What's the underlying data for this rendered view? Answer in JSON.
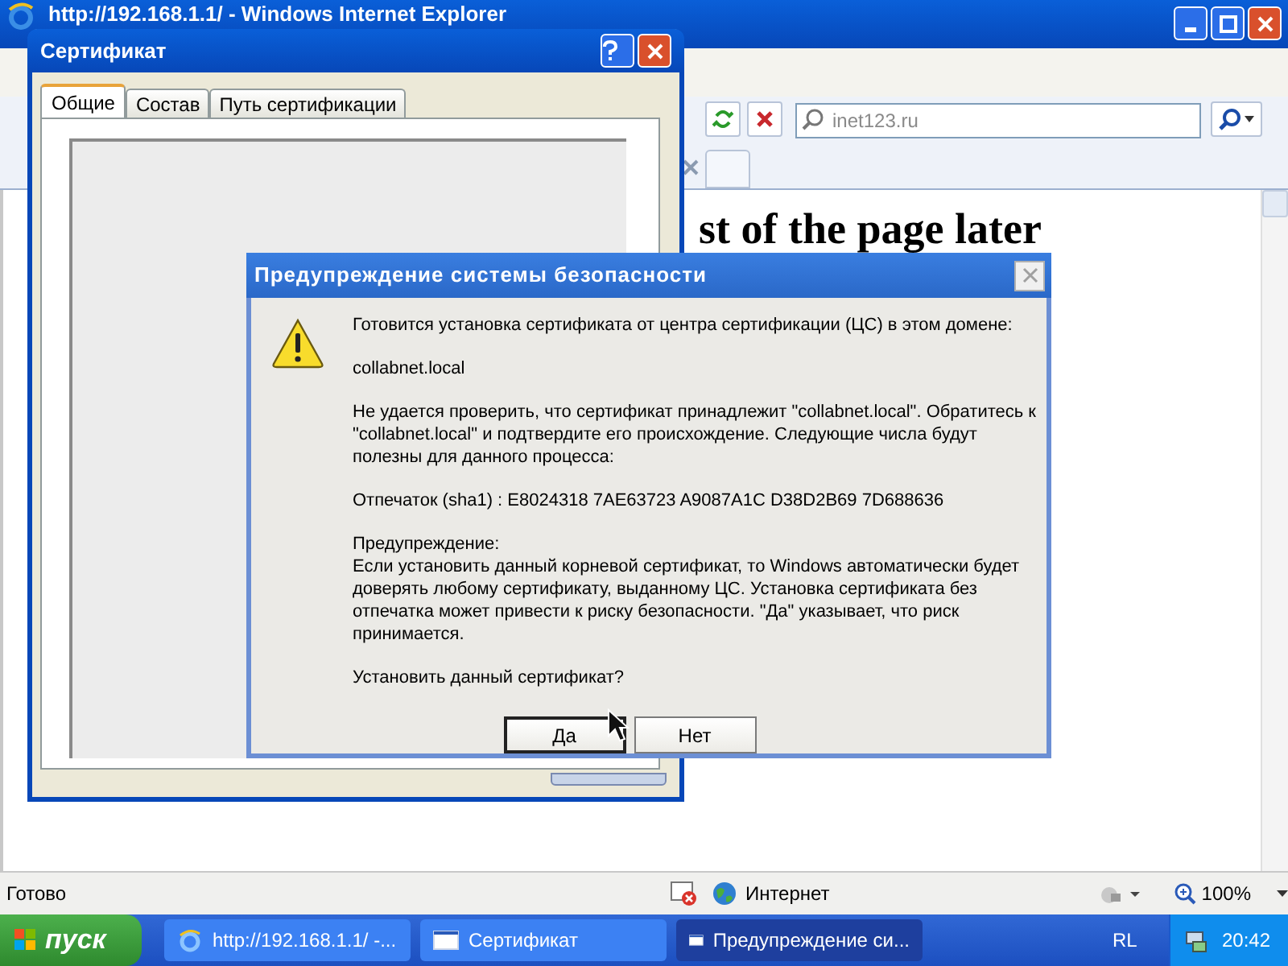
{
  "ie_window": {
    "title": "http://192.168.1.1/ - Windows Internet Explorer",
    "search": {
      "placeholder": "inet123.ru"
    },
    "page_heading": "st of the page later",
    "status_bar": {
      "status": "Готово",
      "zone": "Интернет",
      "zoom": "100%"
    }
  },
  "certificate_window": {
    "title": "Сертификат",
    "tabs": [
      {
        "label": "Общие",
        "selected": true
      },
      {
        "label": "Состав",
        "selected": false
      },
      {
        "label": "Путь сертификации",
        "selected": false
      }
    ]
  },
  "security_dialog": {
    "title": "Предупреждение системы безопасности",
    "paragraphs": [
      [
        "Готовится установка сертификата от центра сертификации (ЦС) в этом домене:"
      ],
      [
        "collabnet.local"
      ],
      [
        "Не удается проверить, что сертификат принадлежит \"collabnet.local\". Обратитесь к \"collabnet.local\" и подтвердите его происхождение. Следующие числа будут полезны для данного процесса:"
      ],
      [
        "Отпечаток (sha1) : E8024318 7AE63723 A9087A1C D38D2B69 7D688636"
      ],
      [
        "Предупреждение:",
        "Если установить данный корневой сертификат, то Windows автоматически будет доверять любому сертификату, выданному ЦС. Установка сертификата без отпечатка может привести к риску безопасности. \"Да\" указывает, что риск принимается."
      ],
      [
        "Установить данный сертификат?"
      ]
    ],
    "buttons": [
      {
        "label": "Да",
        "focused": true
      },
      {
        "label": "Нет",
        "focused": false
      }
    ]
  },
  "taskbar": {
    "start": "пуск",
    "tasks": [
      {
        "label": "http://192.168.1.1/ -...",
        "kind": "browser",
        "selected": false
      },
      {
        "label": "Сертификат",
        "kind": "window",
        "selected": false
      },
      {
        "label": "Предупреждение си...",
        "kind": "window",
        "selected": true
      }
    ],
    "language": "RL",
    "clock": "20:42"
  }
}
